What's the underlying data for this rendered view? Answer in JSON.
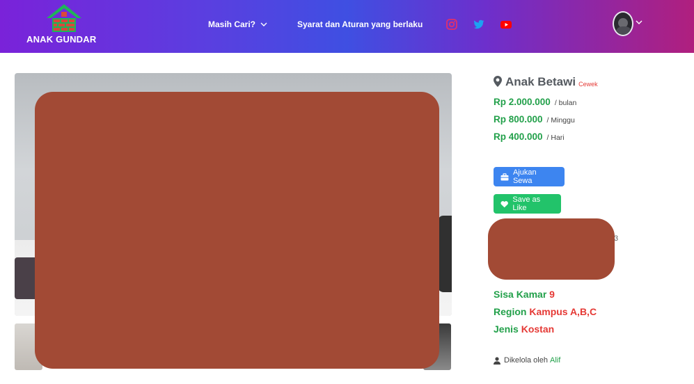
{
  "brand": {
    "name": "ANAK GUNDAR",
    "accent_green": "#22c36a",
    "roof_green": "#1fb35a",
    "brick_red": "#d9483a"
  },
  "nav": {
    "menu_label": "Masih Cari?",
    "menu_icon": "chevron-down-icon",
    "rules_label": "Syarat dan Aturan yang berlaku",
    "social": [
      {
        "name": "instagram-icon",
        "color": "#e1306c"
      },
      {
        "name": "twitter-icon",
        "color": "#1da1f2"
      },
      {
        "name": "youtube-icon",
        "color": "#ff0000"
      }
    ],
    "user_menu_icon": "chevron-down-icon"
  },
  "listing": {
    "location_icon": "map-marker-icon",
    "name": "Anak Betawi",
    "gender_badge": "Cewek",
    "prices": [
      {
        "amount": "Rp 2.000.000",
        "period": "/ bulan"
      },
      {
        "amount": "Rp 800.000",
        "period": "/ Minggu"
      },
      {
        "amount": "Rp 400.000",
        "period": "/ Hari"
      }
    ],
    "actions": {
      "apply_label": "Ajukan Sewa",
      "apply_icon": "briefcase-icon",
      "like_label": "Save as Like",
      "like_icon": "heart-icon"
    },
    "partial_text": "3",
    "details": [
      {
        "label": "Sisa Kamar",
        "value": "9"
      },
      {
        "label": "Region",
        "value": "Kampus A,B,C"
      },
      {
        "label": "Jenis",
        "value": "Kostan"
      }
    ],
    "managed_prefix": "Dikelola oleh",
    "manager_name": "Alif",
    "managed_icon": "user-icon"
  },
  "colors": {
    "redaction": "#a24a35",
    "price_green": "#22a04a",
    "value_red": "#e53935",
    "apply_blue": "#3d85f0"
  }
}
